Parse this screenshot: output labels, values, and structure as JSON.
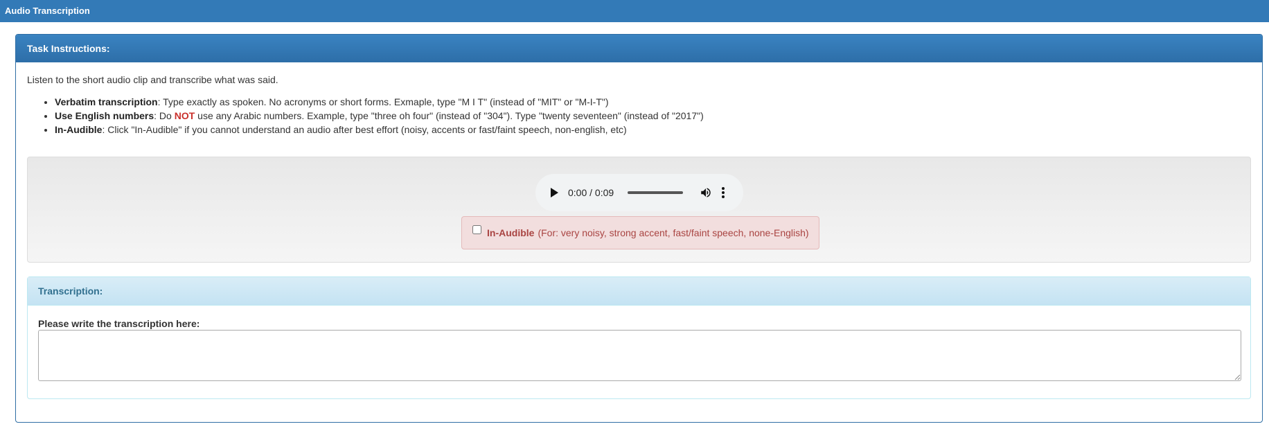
{
  "app": {
    "title": "Audio Transcription"
  },
  "task_panel": {
    "heading": "Task Instructions:",
    "intro": "Listen to the short audio clip and transcribe what was said.",
    "rules": [
      {
        "term": "Verbatim transcription",
        "text": ": Type exactly as spoken. No acronyms or short forms. Exmaple, type \"M I T\" (instead of \"MIT\" or \"M-I-T\")"
      },
      {
        "term": "Use English numbers",
        "pre": ": Do ",
        "emphasis": "NOT",
        "text": " use any Arabic numbers. Example, type \"three oh four\" (instead of \"304\"). Type \"twenty seventeen\" (instead of \"2017\")"
      },
      {
        "term": "In-Audible",
        "text": ": Click \"In-Audible\" if you cannot understand an audio after best effort (noisy, accents or fast/faint speech, non-english, etc)"
      }
    ]
  },
  "audio_player": {
    "time": "0:00 / 0:09",
    "progress": 0,
    "icons": {
      "play": "play-icon",
      "volume": "volume-icon",
      "menu": "more-vert-icon"
    }
  },
  "inaudible": {
    "checked": false,
    "label": "In-Audible",
    "hint": "(For: very noisy, strong accent, fast/faint speech, none-English)",
    "color": "#a94442",
    "background": "#f2dede"
  },
  "transcription": {
    "heading": "Transcription:",
    "prompt": "Please write the transcription here:",
    "value": ""
  },
  "colors": {
    "primary": "#337ab7",
    "info_text": "#31708f",
    "info_bg": "#d9edf7",
    "danger": "#c9302c"
  }
}
